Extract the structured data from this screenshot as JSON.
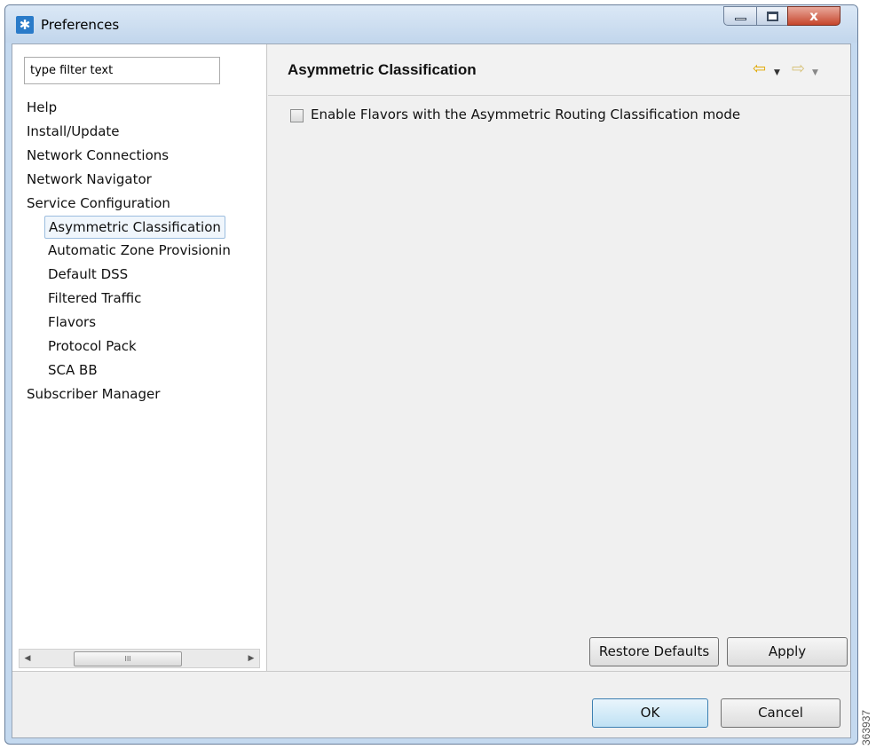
{
  "window": {
    "title": "Preferences",
    "close_label": "x"
  },
  "left": {
    "filter": {
      "placeholder": "type filter text",
      "value": "type filter text"
    },
    "tree": [
      {
        "label": "Help",
        "level": 0
      },
      {
        "label": "Install/Update",
        "level": 0
      },
      {
        "label": "Network Connections",
        "level": 0
      },
      {
        "label": "Network Navigator",
        "level": 0
      },
      {
        "label": "Service Configuration",
        "level": 0
      },
      {
        "label": "Asymmetric Classification",
        "level": 1,
        "selected": true
      },
      {
        "label": "Automatic Zone Provisionin",
        "level": 1
      },
      {
        "label": "Default DSS",
        "level": 1
      },
      {
        "label": "Filtered Traffic",
        "level": 1
      },
      {
        "label": "Flavors",
        "level": 1
      },
      {
        "label": "Protocol Pack",
        "level": 1
      },
      {
        "label": "SCA BB",
        "level": 1
      },
      {
        "label": "Subscriber Manager",
        "level": 0
      }
    ],
    "scrollbar_thumb_glyph": "III"
  },
  "page": {
    "title": "Asymmetric Classification",
    "checkbox_label": "Enable Flavors with the Asymmetric Routing Classification mode",
    "checkbox_checked": false,
    "restore_label": "Restore Defaults",
    "apply_label": "Apply"
  },
  "footer": {
    "ok_label": "OK",
    "cancel_label": "Cancel"
  },
  "watermark": "363937",
  "colors": {
    "accent_back_arrow": "#e0a800",
    "selection_bg": "#f0f6fc",
    "selection_border": "#9cbddf"
  }
}
